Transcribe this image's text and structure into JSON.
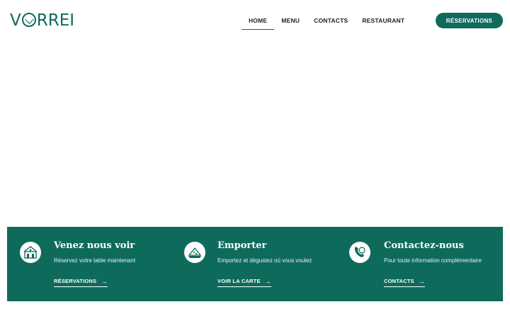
{
  "brand": {
    "logo_text_prefix": "V",
    "logo_text_suffix": "RREI",
    "color": "#0e6b5c"
  },
  "nav": {
    "items": [
      {
        "label": "HOME",
        "active": true
      },
      {
        "label": "MENU",
        "active": false
      },
      {
        "label": "CONTACTS",
        "active": false
      },
      {
        "label": "RESTAURANT",
        "active": false
      }
    ],
    "cta_label": "RÉSERVATIONS"
  },
  "features": [
    {
      "icon": "restaurant-building-icon",
      "title": "Venez nous voir",
      "subtitle": "Réservez votre table maintenant",
      "link_label": "RÉSERVATIONS"
    },
    {
      "icon": "pizza-box-icon",
      "title": "Emporter",
      "subtitle": "Emportez et dégustez où vous voulez",
      "link_label": "VOIR LA CARTE"
    },
    {
      "icon": "phone-dish-icon",
      "title": "Contactez-nous",
      "subtitle": "Pour toute information complémentaire",
      "link_label": "CONTACTS"
    }
  ],
  "colors": {
    "accent": "#0e6b5c",
    "text": "#1a1a1a",
    "background": "#ffffff"
  }
}
